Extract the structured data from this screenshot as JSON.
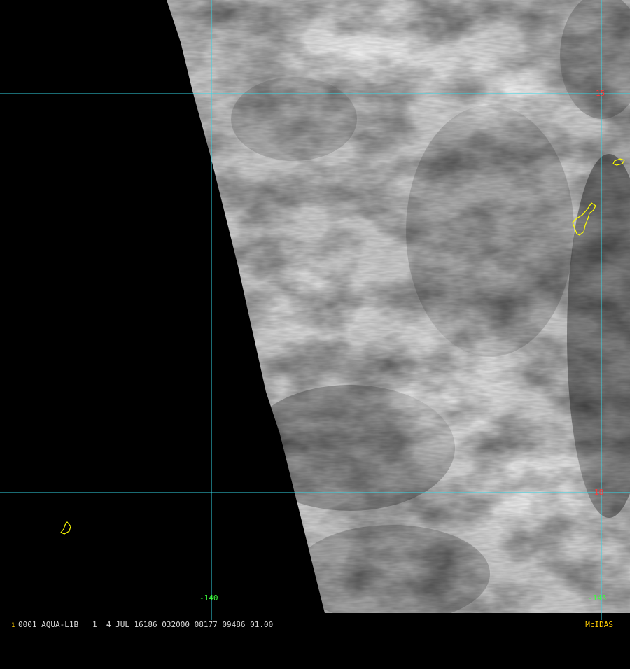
{
  "image": {
    "satellite_view": "visible-band satellite imagery with cloud cover",
    "grid_color": "#33d6e6",
    "lat_label_color": "#ff3b3b",
    "lon_label_color": "#3cff3c",
    "coastline_color": "#ffff00"
  },
  "grid": {
    "lat_labels": [
      "15",
      "10"
    ],
    "lon_labels": [
      "-140",
      "-145"
    ]
  },
  "status_bar": {
    "frame": "1",
    "text": "0001 AQUA-L1B   1  4 JUL 16186 032000 08177 09486 01.00",
    "brand": "McIDAS",
    "text_color": "#d8d8d8",
    "brand_color": "#ffcc00"
  }
}
